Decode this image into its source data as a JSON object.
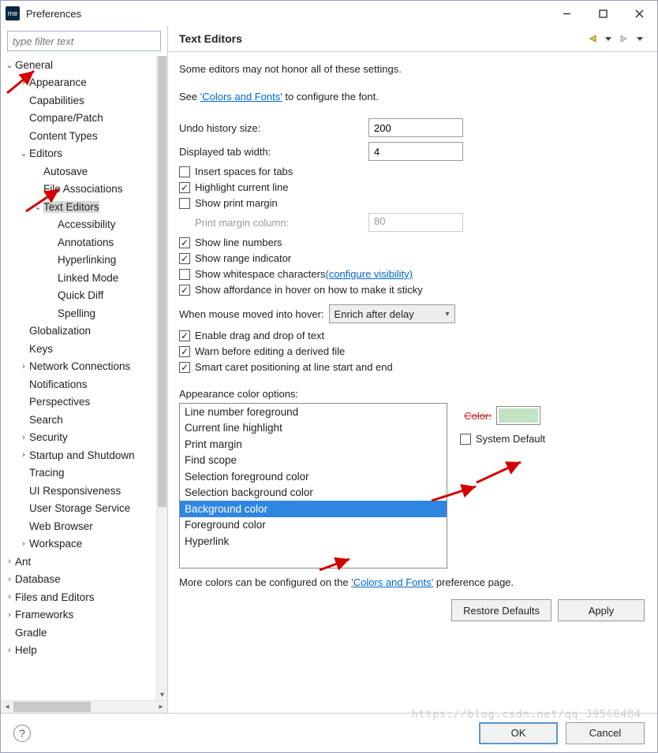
{
  "window": {
    "title": "Preferences",
    "icon_text": "me"
  },
  "filter_placeholder": "type filter text",
  "tree": [
    {
      "d": 1,
      "t": "v",
      "label": "General",
      "sel": false
    },
    {
      "d": 2,
      "t": ">",
      "label": "Appearance"
    },
    {
      "d": 2,
      "t": "",
      "label": "Capabilities"
    },
    {
      "d": 2,
      "t": "",
      "label": "Compare/Patch"
    },
    {
      "d": 2,
      "t": "",
      "label": "Content Types"
    },
    {
      "d": 2,
      "t": "v",
      "label": "Editors"
    },
    {
      "d": 3,
      "t": "",
      "label": "Autosave"
    },
    {
      "d": 3,
      "t": "",
      "label": "File Associations"
    },
    {
      "d": 3,
      "t": "v",
      "label": "Text Editors",
      "sel": true
    },
    {
      "d": 4,
      "t": "",
      "label": "Accessibility"
    },
    {
      "d": 4,
      "t": "",
      "label": "Annotations"
    },
    {
      "d": 4,
      "t": "",
      "label": "Hyperlinking"
    },
    {
      "d": 4,
      "t": "",
      "label": "Linked Mode"
    },
    {
      "d": 4,
      "t": "",
      "label": "Quick Diff"
    },
    {
      "d": 4,
      "t": "",
      "label": "Spelling"
    },
    {
      "d": 2,
      "t": "",
      "label": "Globalization"
    },
    {
      "d": 2,
      "t": "",
      "label": "Keys"
    },
    {
      "d": 2,
      "t": ">",
      "label": "Network Connections"
    },
    {
      "d": 2,
      "t": "",
      "label": "Notifications"
    },
    {
      "d": 2,
      "t": "",
      "label": "Perspectives"
    },
    {
      "d": 2,
      "t": "",
      "label": "Search"
    },
    {
      "d": 2,
      "t": ">",
      "label": "Security"
    },
    {
      "d": 2,
      "t": ">",
      "label": "Startup and Shutdown"
    },
    {
      "d": 2,
      "t": "",
      "label": "Tracing"
    },
    {
      "d": 2,
      "t": "",
      "label": "UI Responsiveness"
    },
    {
      "d": 2,
      "t": "",
      "label": "User Storage Service"
    },
    {
      "d": 2,
      "t": "",
      "label": "Web Browser"
    },
    {
      "d": 2,
      "t": ">",
      "label": "Workspace"
    },
    {
      "d": 1,
      "t": ">",
      "label": "Ant"
    },
    {
      "d": 1,
      "t": ">",
      "label": "Database"
    },
    {
      "d": 1,
      "t": ">",
      "label": "Files and Editors"
    },
    {
      "d": 1,
      "t": ">",
      "label": "Frameworks"
    },
    {
      "d": 1,
      "t": "",
      "label": "Gradle"
    },
    {
      "d": 1,
      "t": ">",
      "label": "Help"
    }
  ],
  "page_title": "Text Editors",
  "desc_line1": "Some editors may not honor all of these settings.",
  "desc_line2a": "See ",
  "desc_link1": "'Colors and Fonts'",
  "desc_line2b": " to configure the font.",
  "undo_label": "Undo history size:",
  "undo_value": "200",
  "tabw_label": "Displayed tab width:",
  "tabw_value": "4",
  "cb_insert_spaces": "Insert spaces for tabs",
  "cb_highlight_line": "Highlight current line",
  "cb_print_margin": "Show print margin",
  "pm_col_label": "Print margin column:",
  "pm_col_value": "80",
  "cb_line_numbers": "Show line numbers",
  "cb_range_indicator": "Show range indicator",
  "cb_whitespace": "Show whitespace characters ",
  "cb_whitespace_link": "(configure visibility)",
  "cb_affordance": "Show affordance in hover on how to make it sticky",
  "hover_label": "When mouse moved into hover:",
  "hover_value": "Enrich after delay",
  "cb_dragdrop": "Enable drag and drop of text",
  "cb_warn_derived": "Warn before editing a derived file",
  "cb_smart_caret": "Smart caret positioning at line start and end",
  "color_options_label": "Appearance color options:",
  "color_list": [
    "Line number foreground",
    "Current line highlight",
    "Print margin",
    "Find scope",
    "Selection foreground color",
    "Selection background color",
    "Background color",
    "Foreground color",
    "Hyperlink"
  ],
  "color_list_selected": "Background color",
  "color_label": "Color:",
  "color_swatch": "#c1e3c1",
  "system_default_label": "System Default",
  "more_colors_a": "More colors can be configured on the ",
  "more_colors_link": "'Colors and Fonts'",
  "more_colors_b": " preference page.",
  "btn_restore": "Restore Defaults",
  "btn_apply": "Apply",
  "btn_ok": "OK",
  "btn_cancel": "Cancel",
  "watermark": "https://blog.csdn.net/qq_39560484"
}
